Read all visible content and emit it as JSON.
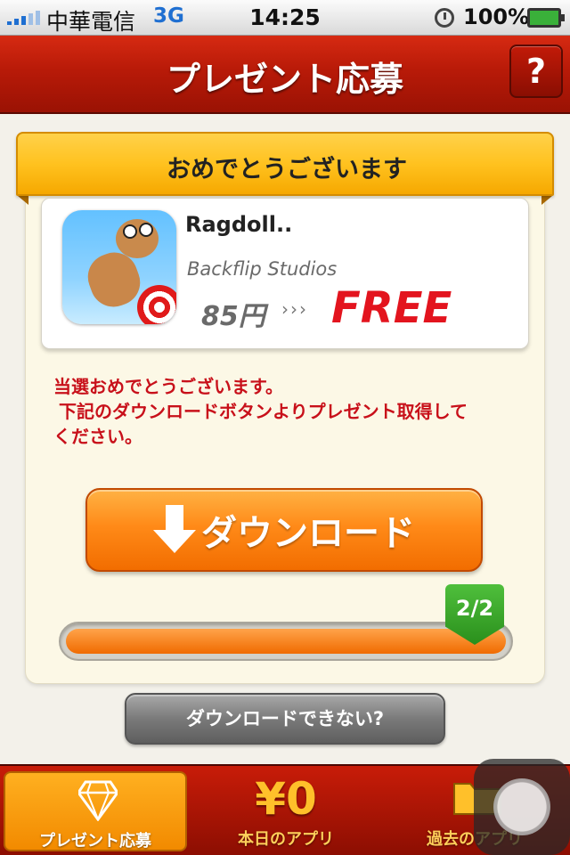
{
  "status_bar": {
    "carrier": "中華電信",
    "network": "3G",
    "time": "14:25",
    "battery": "100%"
  },
  "header": {
    "title": "プレゼント応募",
    "help_label": "?"
  },
  "card": {
    "ribbon_title": "おめでとうございます",
    "app": {
      "name": "Ragdoll..",
      "developer": "Backflip Studios",
      "price": "85円",
      "arrow": "›››",
      "free_label": "FREE"
    },
    "message_lines": [
      "当選おめでとうございます。",
      "下記のダウンロードボタンよりプレゼント取得して",
      "ください。"
    ],
    "download_label": "ダウンロード",
    "progress": {
      "label": "2/2",
      "fraction": 1.0
    },
    "cant_download_label": "ダウンロードできない?"
  },
  "tabbar": {
    "tabs": [
      {
        "label": "プレゼント応募",
        "icon": "diamond-icon",
        "active": true
      },
      {
        "label": "本日のアプリ",
        "icon_text": "¥0",
        "active": false
      },
      {
        "label": "過去のアプリ",
        "icon": "folder-icon",
        "active": false
      }
    ]
  },
  "colors": {
    "header_red": "#b81a08",
    "ribbon_yellow": "#ffc21f",
    "download_orange": "#ff8a18",
    "message_red": "#c8101a",
    "free_red": "#e3141e"
  }
}
